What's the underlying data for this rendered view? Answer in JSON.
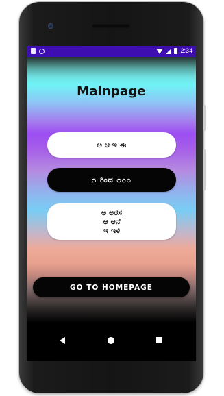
{
  "status_bar": {
    "time": "2:34"
  },
  "app": {
    "title": "Mainpage"
  },
  "cards": [
    {
      "lines": [
        "ಅ ಆ ಇ ಈ"
      ]
    },
    {
      "lines": [
        "೧ ರಿಂದ ೧೦೦"
      ]
    },
    {
      "lines": [
        "ಅ ಅರಸ",
        "ಆ ಆನೆ",
        "ಇ ಇಳಿ"
      ]
    }
  ],
  "actions": {
    "go_home": "GO TO HOMEPAGE"
  },
  "colors": {
    "status_bar": "#3f0eb0",
    "button_dark": "#050505",
    "button_light": "#ffffff"
  },
  "icons": [
    "nav-back-icon",
    "nav-home-icon",
    "nav-recents-icon",
    "wifi-icon",
    "signal-icon",
    "battery-icon"
  ]
}
